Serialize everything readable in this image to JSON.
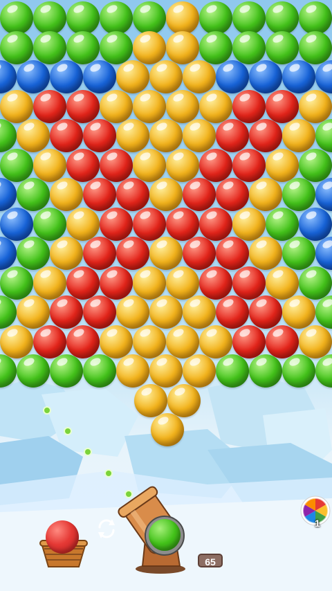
{
  "colors": {
    "green": "#43c21a",
    "yellow": "#f2b21b",
    "blue": "#1763d8",
    "red": "#e3241a",
    "aim_dot": "#7bd33a"
  },
  "bubble_rows": [
    [
      "green",
      "green",
      "green",
      "green",
      "green",
      "yellow",
      "green",
      "green",
      "green",
      "green"
    ],
    [
      "green",
      "green",
      "green",
      "green",
      "yellow",
      "yellow",
      "green",
      "green",
      "green",
      "green"
    ],
    [
      "blue",
      "blue",
      "blue",
      "blue",
      "yellow",
      "yellow",
      "yellow",
      "blue",
      "blue",
      "blue",
      "blue"
    ],
    [
      "yellow",
      "red",
      "red",
      "yellow",
      "yellow",
      "yellow",
      "yellow",
      "red",
      "red",
      "yellow"
    ],
    [
      "green",
      "yellow",
      "red",
      "red",
      "yellow",
      "yellow",
      "yellow",
      "red",
      "red",
      "yellow",
      "green"
    ],
    [
      "green",
      "yellow",
      "red",
      "red",
      "yellow",
      "yellow",
      "red",
      "red",
      "yellow",
      "green"
    ],
    [
      "blue",
      "green",
      "yellow",
      "red",
      "red",
      "yellow",
      "red",
      "red",
      "yellow",
      "green",
      "blue"
    ],
    [
      "blue",
      "green",
      "yellow",
      "red",
      "red",
      "red",
      "red",
      "yellow",
      "green",
      "blue"
    ],
    [
      "blue",
      "green",
      "yellow",
      "red",
      "red",
      "yellow",
      "red",
      "red",
      "yellow",
      "green",
      "blue"
    ],
    [
      "green",
      "yellow",
      "red",
      "red",
      "yellow",
      "yellow",
      "red",
      "red",
      "yellow",
      "green"
    ],
    [
      "green",
      "yellow",
      "red",
      "red",
      "yellow",
      "yellow",
      "yellow",
      "red",
      "red",
      "yellow",
      "green"
    ],
    [
      "yellow",
      "red",
      "red",
      "yellow",
      "yellow",
      "yellow",
      "yellow",
      "red",
      "red",
      "yellow"
    ],
    [
      "green",
      "green",
      "green",
      "green",
      "yellow",
      "yellow",
      "yellow",
      "green",
      "green",
      "green",
      "green"
    ],
    [
      "yellow",
      "yellow"
    ],
    [
      "yellow"
    ]
  ],
  "next_ball_color": "red",
  "loaded_ball_color": "green",
  "shots_remaining": "65",
  "powerup": {
    "name": "rainbow-ball",
    "count": "1"
  },
  "icons": {
    "swap": "swap-icon",
    "powerup": "rainbow-ball-icon"
  }
}
